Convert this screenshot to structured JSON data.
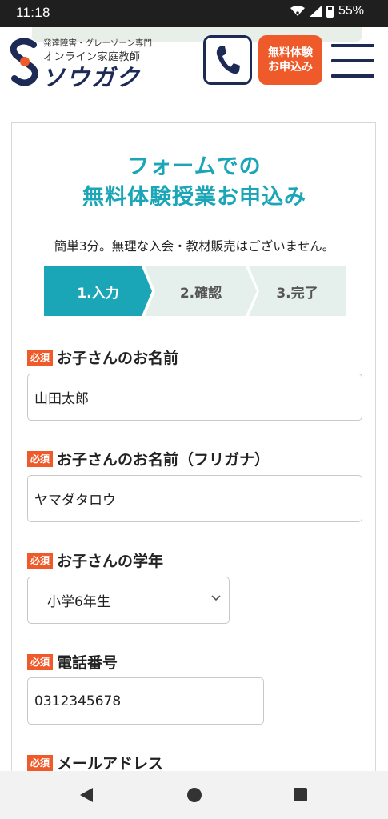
{
  "status": {
    "time": "11:18",
    "battery": "55%"
  },
  "header": {
    "logo_tagline": "発達障害・グレーゾーン専門",
    "logo_subtitle": "オンライン家庭教師",
    "logo_name": "ソウガク",
    "trial_button_line1": "無料体験",
    "trial_button_line2": "お申込み"
  },
  "form": {
    "title_line1": "フォームでの",
    "title_line2": "無料体験授業お申込み",
    "lead": "簡単3分。無理な入会・教材販売はございません。",
    "steps": [
      {
        "label": "1.入力",
        "active": true
      },
      {
        "label": "2.確認",
        "active": false
      },
      {
        "label": "3.完了",
        "active": false
      }
    ],
    "required_badge": "必須",
    "fields": {
      "child_name": {
        "label": "お子さんのお名前",
        "value": "山田太郎"
      },
      "child_kana": {
        "label": "お子さんのお名前（フリガナ）",
        "value": "ヤマダタロウ"
      },
      "grade": {
        "label": "お子さんの学年",
        "value": "小学6年生"
      },
      "phone": {
        "label": "電話番号",
        "value": "0312345678"
      },
      "email": {
        "label": "メールアドレス"
      }
    }
  },
  "colors": {
    "accent_teal": "#1aa6b7",
    "cta_orange": "#ef5a2a",
    "navy": "#1c2a55",
    "step_inactive": "#e5f0ec"
  }
}
